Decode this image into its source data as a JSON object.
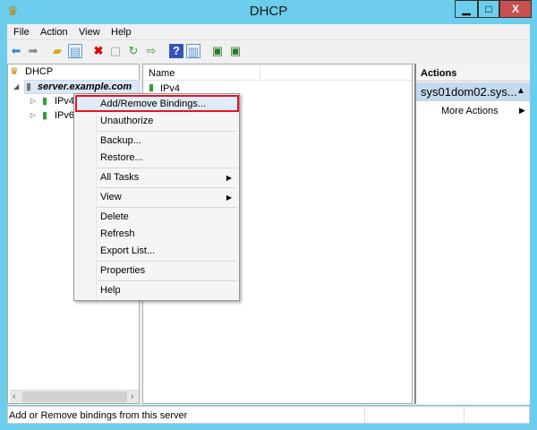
{
  "window": {
    "title": "DHCP",
    "minimize": "▁",
    "maximize": "□",
    "close": "X"
  },
  "menubar": [
    "File",
    "Action",
    "View",
    "Help"
  ],
  "tree": {
    "root": "DHCP",
    "server": "server.example.com",
    "children": [
      "IPv4",
      "IPv6"
    ]
  },
  "list": {
    "column": "Name",
    "items": [
      "IPv4"
    ]
  },
  "actions": {
    "header": "Actions",
    "section": "sys01dom02.sys...",
    "more": "More Actions"
  },
  "context_menu": {
    "items": [
      "Add/Remove Bindings...",
      "Unauthorize",
      "Backup...",
      "Restore...",
      "All Tasks",
      "View",
      "Delete",
      "Refresh",
      "Export List...",
      "Properties",
      "Help"
    ],
    "highlighted": "Add/Remove Bindings..."
  },
  "status": {
    "text": "Add or Remove bindings from this server"
  },
  "colors": {
    "frame": "#6dcdec",
    "close": "#c75050",
    "highlight": "#e81123",
    "selection": "#cce8ff"
  }
}
